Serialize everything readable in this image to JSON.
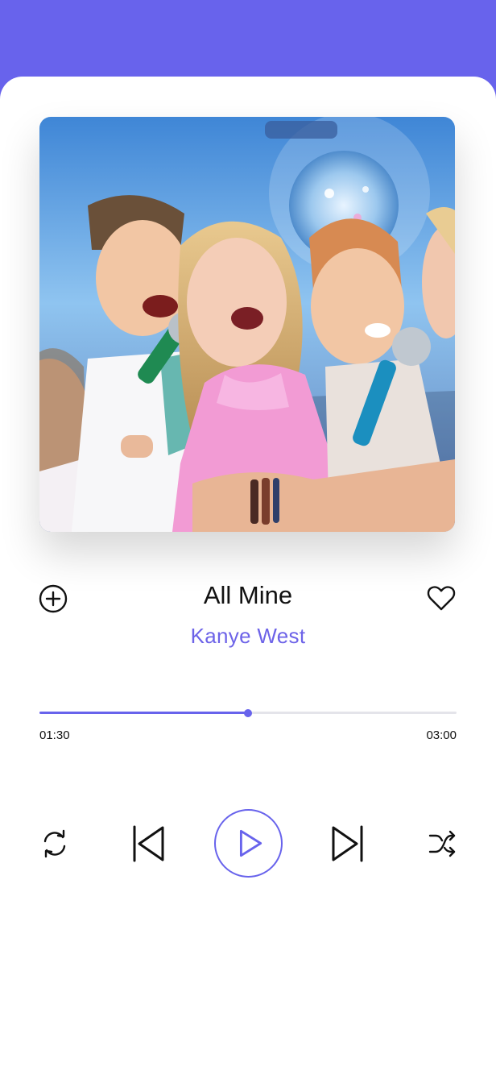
{
  "track": {
    "title": "All Mine",
    "artist": "Kanye West"
  },
  "playback": {
    "elapsed": "01:30",
    "total": "03:00",
    "progress": 0.5
  },
  "artwork": {
    "description_icon": "album-artwork"
  },
  "icons": {
    "add": "add-circle-icon",
    "favorite": "heart-icon",
    "repeat": "repeat-icon",
    "previous": "skip-previous-icon",
    "play": "play-icon",
    "next": "skip-next-icon",
    "shuffle": "shuffle-icon"
  },
  "colors": {
    "accent": "#6863ec",
    "artist_text": "#6d63e8",
    "progress_track": "#e4e4ea",
    "text": "#111111"
  }
}
